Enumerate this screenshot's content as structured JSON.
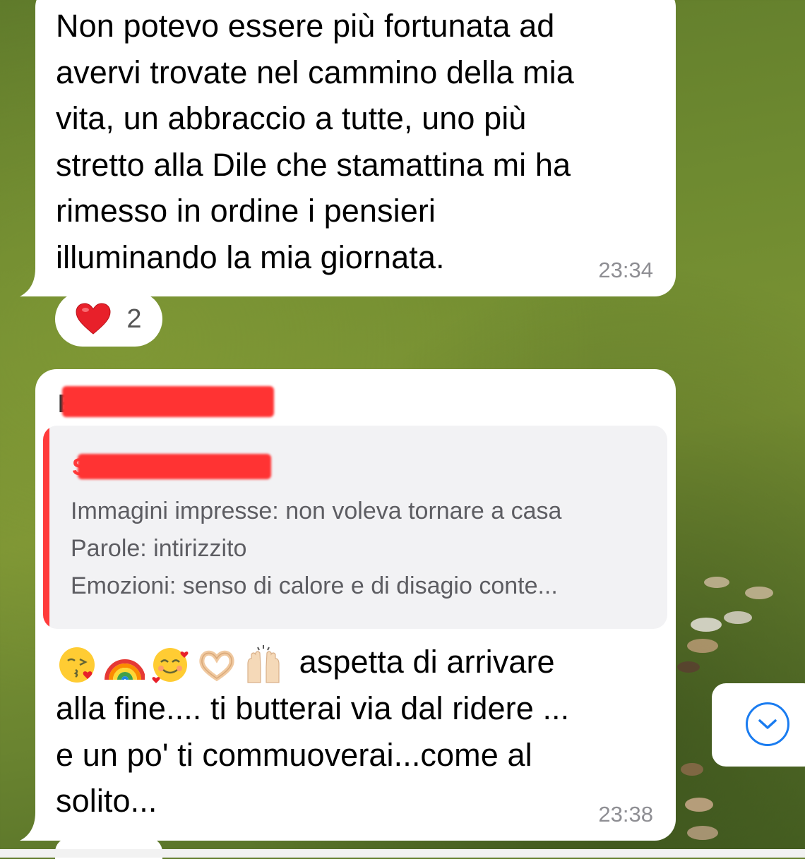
{
  "messages": [
    {
      "text_lines": [
        "Non potevo essere più fortunata ad",
        "avervi trovate nel cammino della mia",
        "vita, un abbraccio a tutte, uno più",
        "stretto alla Dile che stamattina mi ha",
        "rimesso in ordine i pensieri",
        "illuminando la mia giornata."
      ],
      "time": "23:34",
      "reaction": {
        "emoji": "❤️",
        "count": "2"
      }
    },
    {
      "sender": "E",
      "quote": {
        "author_initial": "S",
        "lines": [
          "Immagini impresse: non voleva tornare a casa",
          "Parole: intirizzito",
          "Emozioni: senso di calore e di disagio conte..."
        ]
      },
      "emojis": [
        "😘",
        "🌈",
        "🥰",
        "🫶",
        "🙌"
      ],
      "text_first": "aspetta di arrivare",
      "text_lines": [
        "alla fine.... ti butterai via dal ridere ...",
        "e un po' ti commuoverai...come al",
        "solito..."
      ],
      "time": "23:38"
    }
  ],
  "colors": {
    "accent_blue": "#1a7cf0",
    "quote_bar": "#ff3b3b",
    "redaction": "#ff3333",
    "bubble": "#ffffff"
  },
  "icons": {
    "scroll_down": "chevron-down-circle-icon",
    "reaction": "red-heart-icon"
  }
}
